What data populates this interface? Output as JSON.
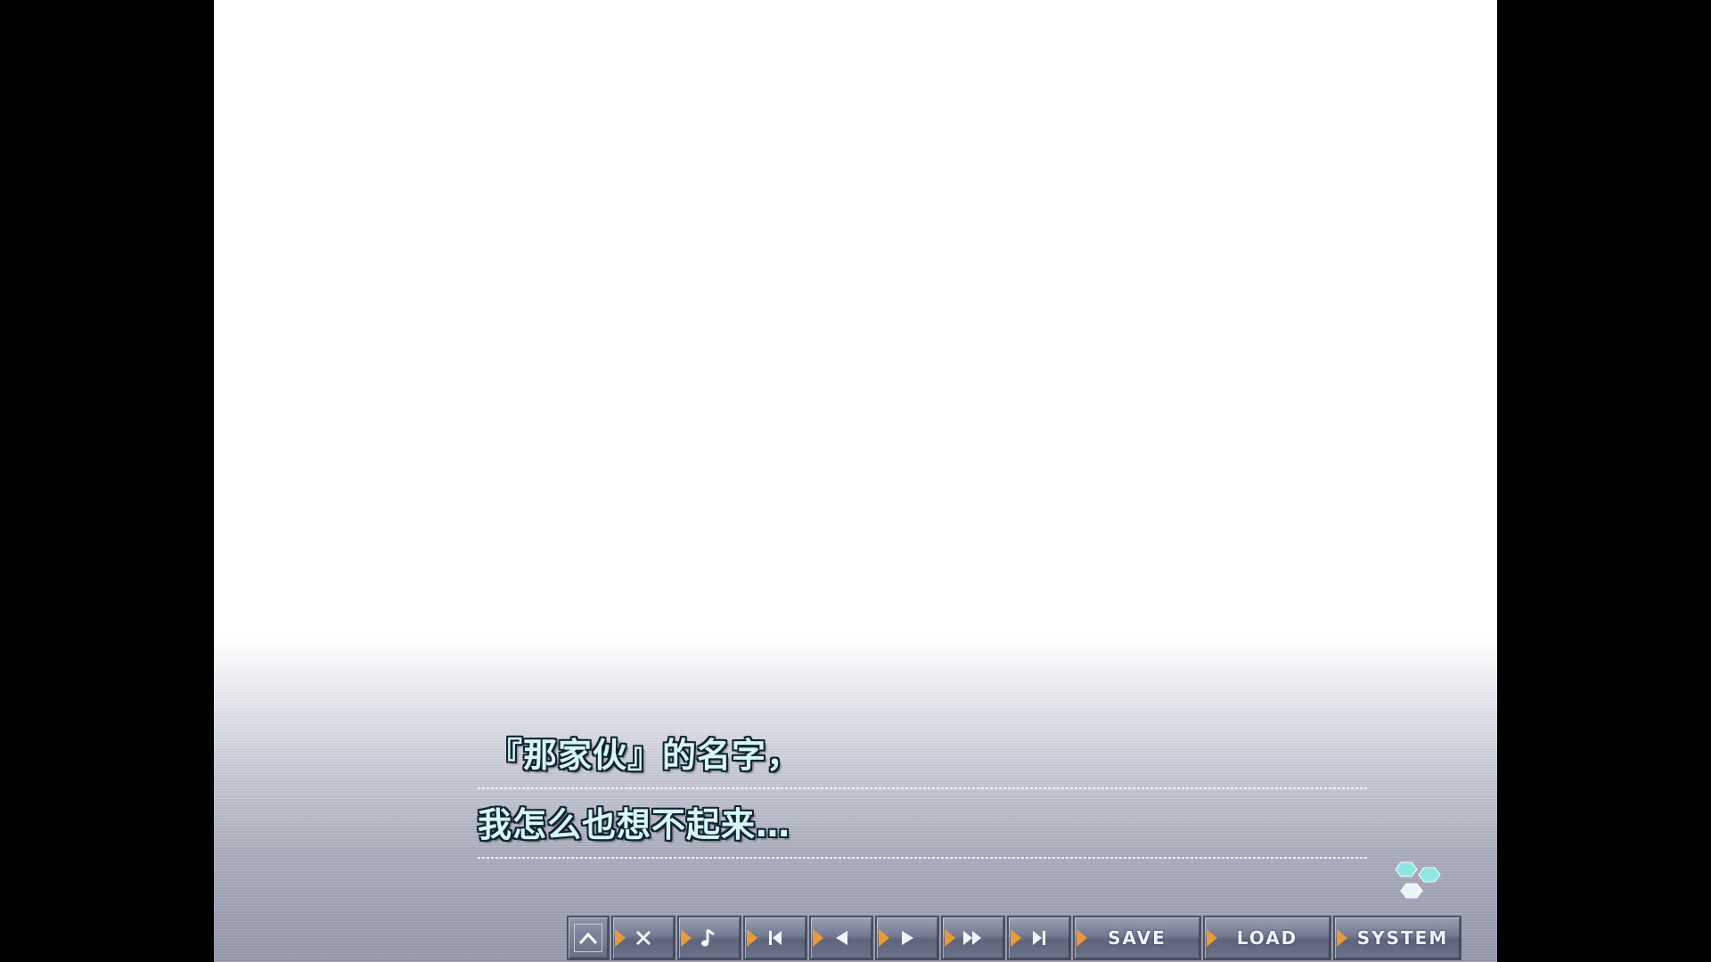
{
  "dialogue": {
    "line1": "『那家伙』的名字，",
    "line2": "我怎么也想不起来…"
  },
  "toolbar": {
    "buttons": [
      {
        "name": "home",
        "icon": "chevron-up-icon"
      },
      {
        "name": "close",
        "icon": "close-icon"
      },
      {
        "name": "music",
        "icon": "music-note-icon"
      },
      {
        "name": "skip-to-start",
        "icon": "skip-back-icon"
      },
      {
        "name": "back",
        "icon": "step-back-icon"
      },
      {
        "name": "play",
        "icon": "play-icon"
      },
      {
        "name": "fast-forward",
        "icon": "fast-forward-icon"
      },
      {
        "name": "skip-to-end",
        "icon": "skip-forward-icon"
      }
    ],
    "save_label": "SAVE",
    "load_label": "LOAD",
    "system_label": "SYSTEM"
  },
  "colors": {
    "text_fill": "#d6f7f4",
    "text_outline": "#112233",
    "button_accent": "#e79a3a",
    "wait_icon": "#8ee6e2"
  }
}
